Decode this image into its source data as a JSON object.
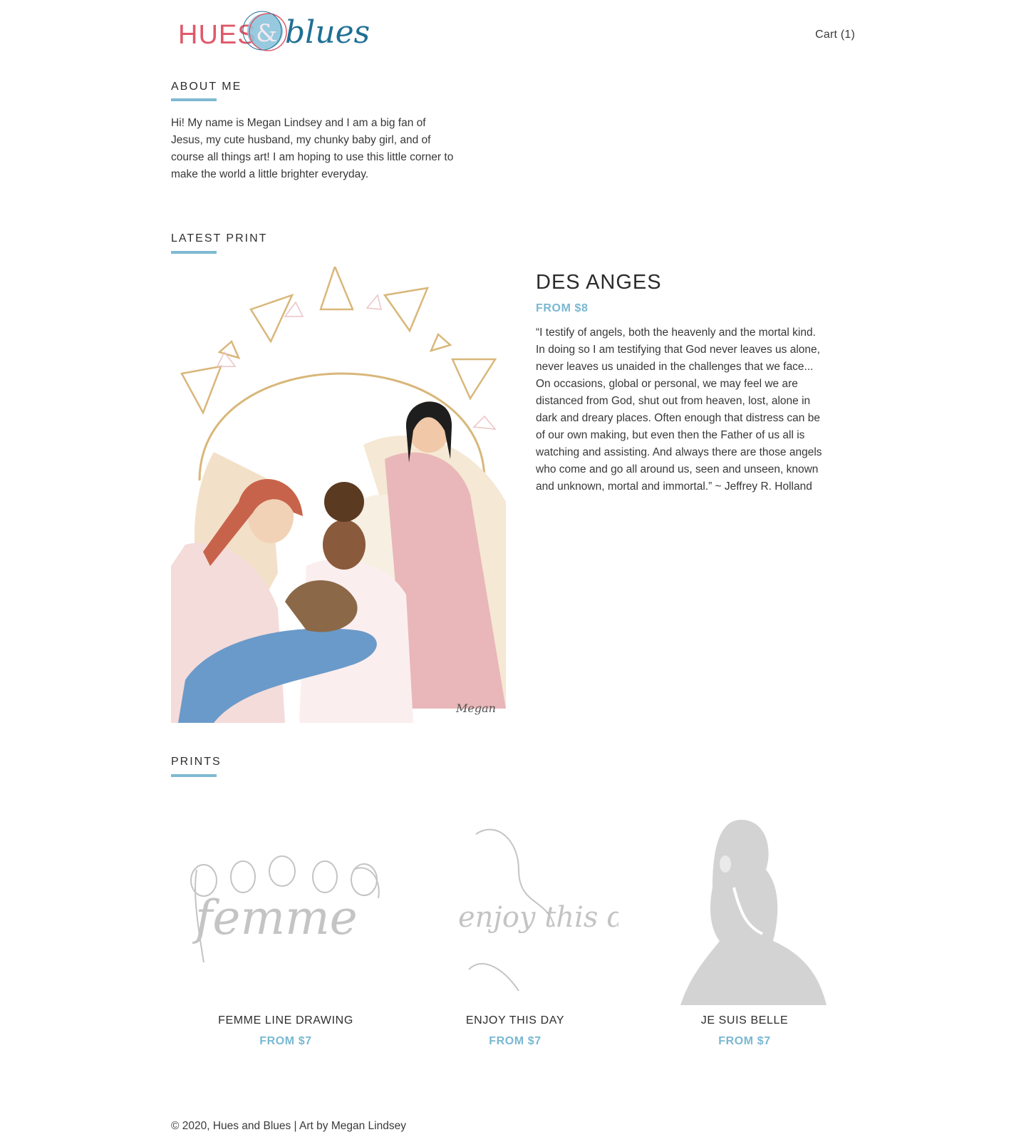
{
  "header": {
    "logo_text_left": "HUES",
    "logo_ampersand": "&",
    "logo_text_right": "blues",
    "cart_label": "Cart (1)"
  },
  "about": {
    "title": "ABOUT ME",
    "text": "Hi! My name is Megan Lindsey and I am a big fan of Jesus, my cute husband, my chunky baby girl, and of course all things art! I am hoping to use this little corner to make the world a little brighter everyday."
  },
  "latest": {
    "section_title": "LATEST PRINT",
    "title": "DES ANGES",
    "price": "FROM $8",
    "description": "“I testify of angels, both the heavenly and the mortal kind. In doing so I am testifying that God never leaves us alone, never leaves us unaided in the challenges that we face... On occasions, global or personal, we may feel we are distanced from God, shut out from heaven, lost, alone in dark and dreary places. Often enough that distress can be of our own making, but even then the Father of us all is watching and assisting. And always there are those angels who come and go all around us, seen and unseen, known and unknown, mortal and immortal.” ~ Jeffrey R. Holland",
    "signature": "Megan"
  },
  "prints": {
    "section_title": "PRINTS",
    "items": [
      {
        "name": "FEMME LINE DRAWING",
        "price": "FROM $7",
        "art_text": "femme"
      },
      {
        "name": "ENJOY THIS DAY",
        "price": "FROM $7",
        "art_text": "enjoy this day"
      },
      {
        "name": "JE SUIS BELLE",
        "price": "FROM $7",
        "art_text": ""
      }
    ]
  },
  "footer": {
    "text": "© 2020, Hues and Blues | Art by Megan Lindsey"
  },
  "colors": {
    "accent": "#7fb9d2",
    "logo_red": "#e0586a",
    "logo_blue": "#1f6f94",
    "text": "#383838"
  }
}
